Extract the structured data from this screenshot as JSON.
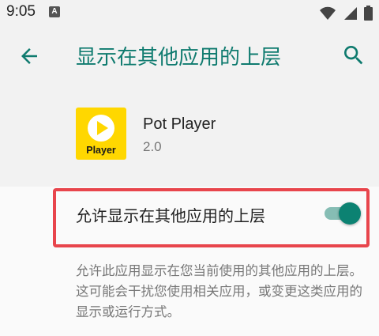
{
  "status_bar": {
    "time": "9:05",
    "notification_icon": "A"
  },
  "header": {
    "title": "显示在其他应用的上层"
  },
  "app": {
    "name": "Pot Player",
    "version": "2.0",
    "icon_label": "Player",
    "icon_color": "#ffd700"
  },
  "setting": {
    "label": "允许显示在其他应用的上层",
    "enabled": true
  },
  "description": "允许此应用显示在您当前使用的其他应用的上层。这可能会干扰您使用相关应用，或变更这类应用的显示或运行方式。",
  "colors": {
    "accent": "#0f7b6f",
    "highlight_border": "#e8454c",
    "app_icon_bg": "#ffd700"
  }
}
